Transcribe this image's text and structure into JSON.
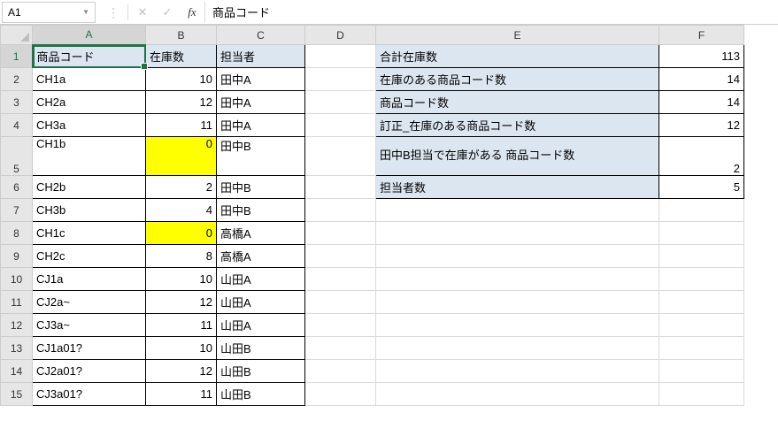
{
  "formula_bar": {
    "name_box": "A1",
    "formula": "商品コード"
  },
  "columns": [
    "A",
    "B",
    "C",
    "D",
    "E",
    "F"
  ],
  "rownums": [
    1,
    2,
    3,
    4,
    5,
    6,
    7,
    8,
    9,
    10,
    11,
    12,
    13,
    14,
    15
  ],
  "active_cell": "A1",
  "table_left": {
    "headers": {
      "a": "商品コード",
      "b": "在庫数",
      "c": "担当者"
    },
    "rows": [
      {
        "a": "CH1a",
        "b": 10,
        "c": "田中A",
        "hl": false
      },
      {
        "a": "CH2a",
        "b": 12,
        "c": "田中A",
        "hl": false
      },
      {
        "a": "CH3a",
        "b": 11,
        "c": "田中A",
        "hl": false
      },
      {
        "a": "CH1b",
        "b": 0,
        "c": "田中B",
        "hl": true
      },
      {
        "a": "CH2b",
        "b": 2,
        "c": "田中B",
        "hl": false
      },
      {
        "a": "CH3b",
        "b": 4,
        "c": "田中B",
        "hl": false
      },
      {
        "a": "CH1c",
        "b": 0,
        "c": "高橋A",
        "hl": true
      },
      {
        "a": "CH2c",
        "b": 8,
        "c": "高橋A",
        "hl": false
      },
      {
        "a": "CJ1a",
        "b": 10,
        "c": "山田A",
        "hl": false
      },
      {
        "a": "CJ2a~",
        "b": 12,
        "c": "山田A",
        "hl": false
      },
      {
        "a": "CJ3a~",
        "b": 11,
        "c": "山田A",
        "hl": false
      },
      {
        "a": "CJ1a01?",
        "b": 10,
        "c": "山田B",
        "hl": false
      },
      {
        "a": "CJ2a01?",
        "b": 12,
        "c": "山田B",
        "hl": false
      },
      {
        "a": "CJ3a01?",
        "b": 11,
        "c": "山田B",
        "hl": false
      }
    ]
  },
  "table_right": [
    {
      "label": "合計在庫数",
      "value": 113,
      "tall": false,
      "multiline": false
    },
    {
      "label": "在庫のある商品コード数",
      "value": 14,
      "tall": false,
      "multiline": false
    },
    {
      "label": "商品コード数",
      "value": 14,
      "tall": false,
      "multiline": false
    },
    {
      "label": "訂正_在庫のある商品コード数",
      "value": 12,
      "tall": false,
      "multiline": false
    },
    {
      "label": "田中B担当で在庫がある\n商品コード数",
      "value": 2,
      "tall": true,
      "multiline": true
    },
    {
      "label": "担当者数",
      "value": 5,
      "tall": false,
      "multiline": false
    }
  ]
}
